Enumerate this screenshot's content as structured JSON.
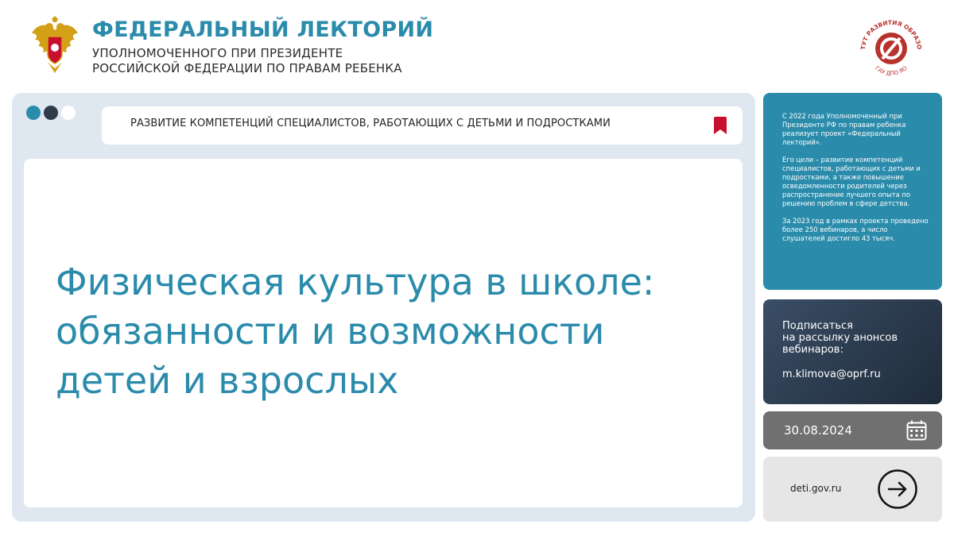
{
  "header": {
    "title": "ФЕДЕРАЛЬНЫЙ ЛЕКТОРИЙ",
    "subtitle_line1": "УПОЛНОМОЧЕННОГО ПРИ ПРЕЗИДЕНТЕ",
    "subtitle_line2": "РОССИЙСКОЙ ФЕДЕРАЦИИ ПО ПРАВАМ РЕБЕНКА",
    "logo_text": "ИНСТИТУТ РАЗВИТИЯ ОБРАЗОВАНИЯ",
    "logo_subtext": "ГАУ ДПО ЯО"
  },
  "browser": {
    "address_text": "РАЗВИТИЕ КОМПЕТЕНЦИЙ СПЕЦИАЛИСТОВ, РАБОТАЮЩИХ С ДЕТЬМИ И ПОДРОСТКАМИ",
    "title_line1": "Физическая культура в школе:",
    "title_line2": "обязанности и возможности",
    "title_line3": "детей и взрослых"
  },
  "info": {
    "p1": "С 2022 года Уполномоченный при Президенте РФ по правам ребенка реализует проект «Федеральный лекторий».",
    "p2": "Его цели – развитие компетенций специалистов, работающих с детьми и подростками, а также повышение осведомленности родителей через распространение лучшего опыта по решению проблем в сфере детства.",
    "p3": "За 2023 год в рамках проекта проведено более 250 вебинаров, а число слушателей достигло 43 тысяч."
  },
  "subscribe": {
    "line1": "Подписаться",
    "line2": "на рассылку анонсов",
    "line3": "вебинаров:",
    "email": "m.klimova@oprf.ru"
  },
  "date": "30.08.2024",
  "link": {
    "label": "deti.gov.ru"
  },
  "colors": {
    "accent": "#2a8bab",
    "dark": "#2f3b48",
    "bookmark": "#c8102e",
    "date_bg": "#707070",
    "logo_red": "#b8322c"
  },
  "icons": [
    "emblem-icon",
    "institute-logo",
    "bookmark-icon",
    "calendar-icon",
    "arrow-right-icon"
  ]
}
